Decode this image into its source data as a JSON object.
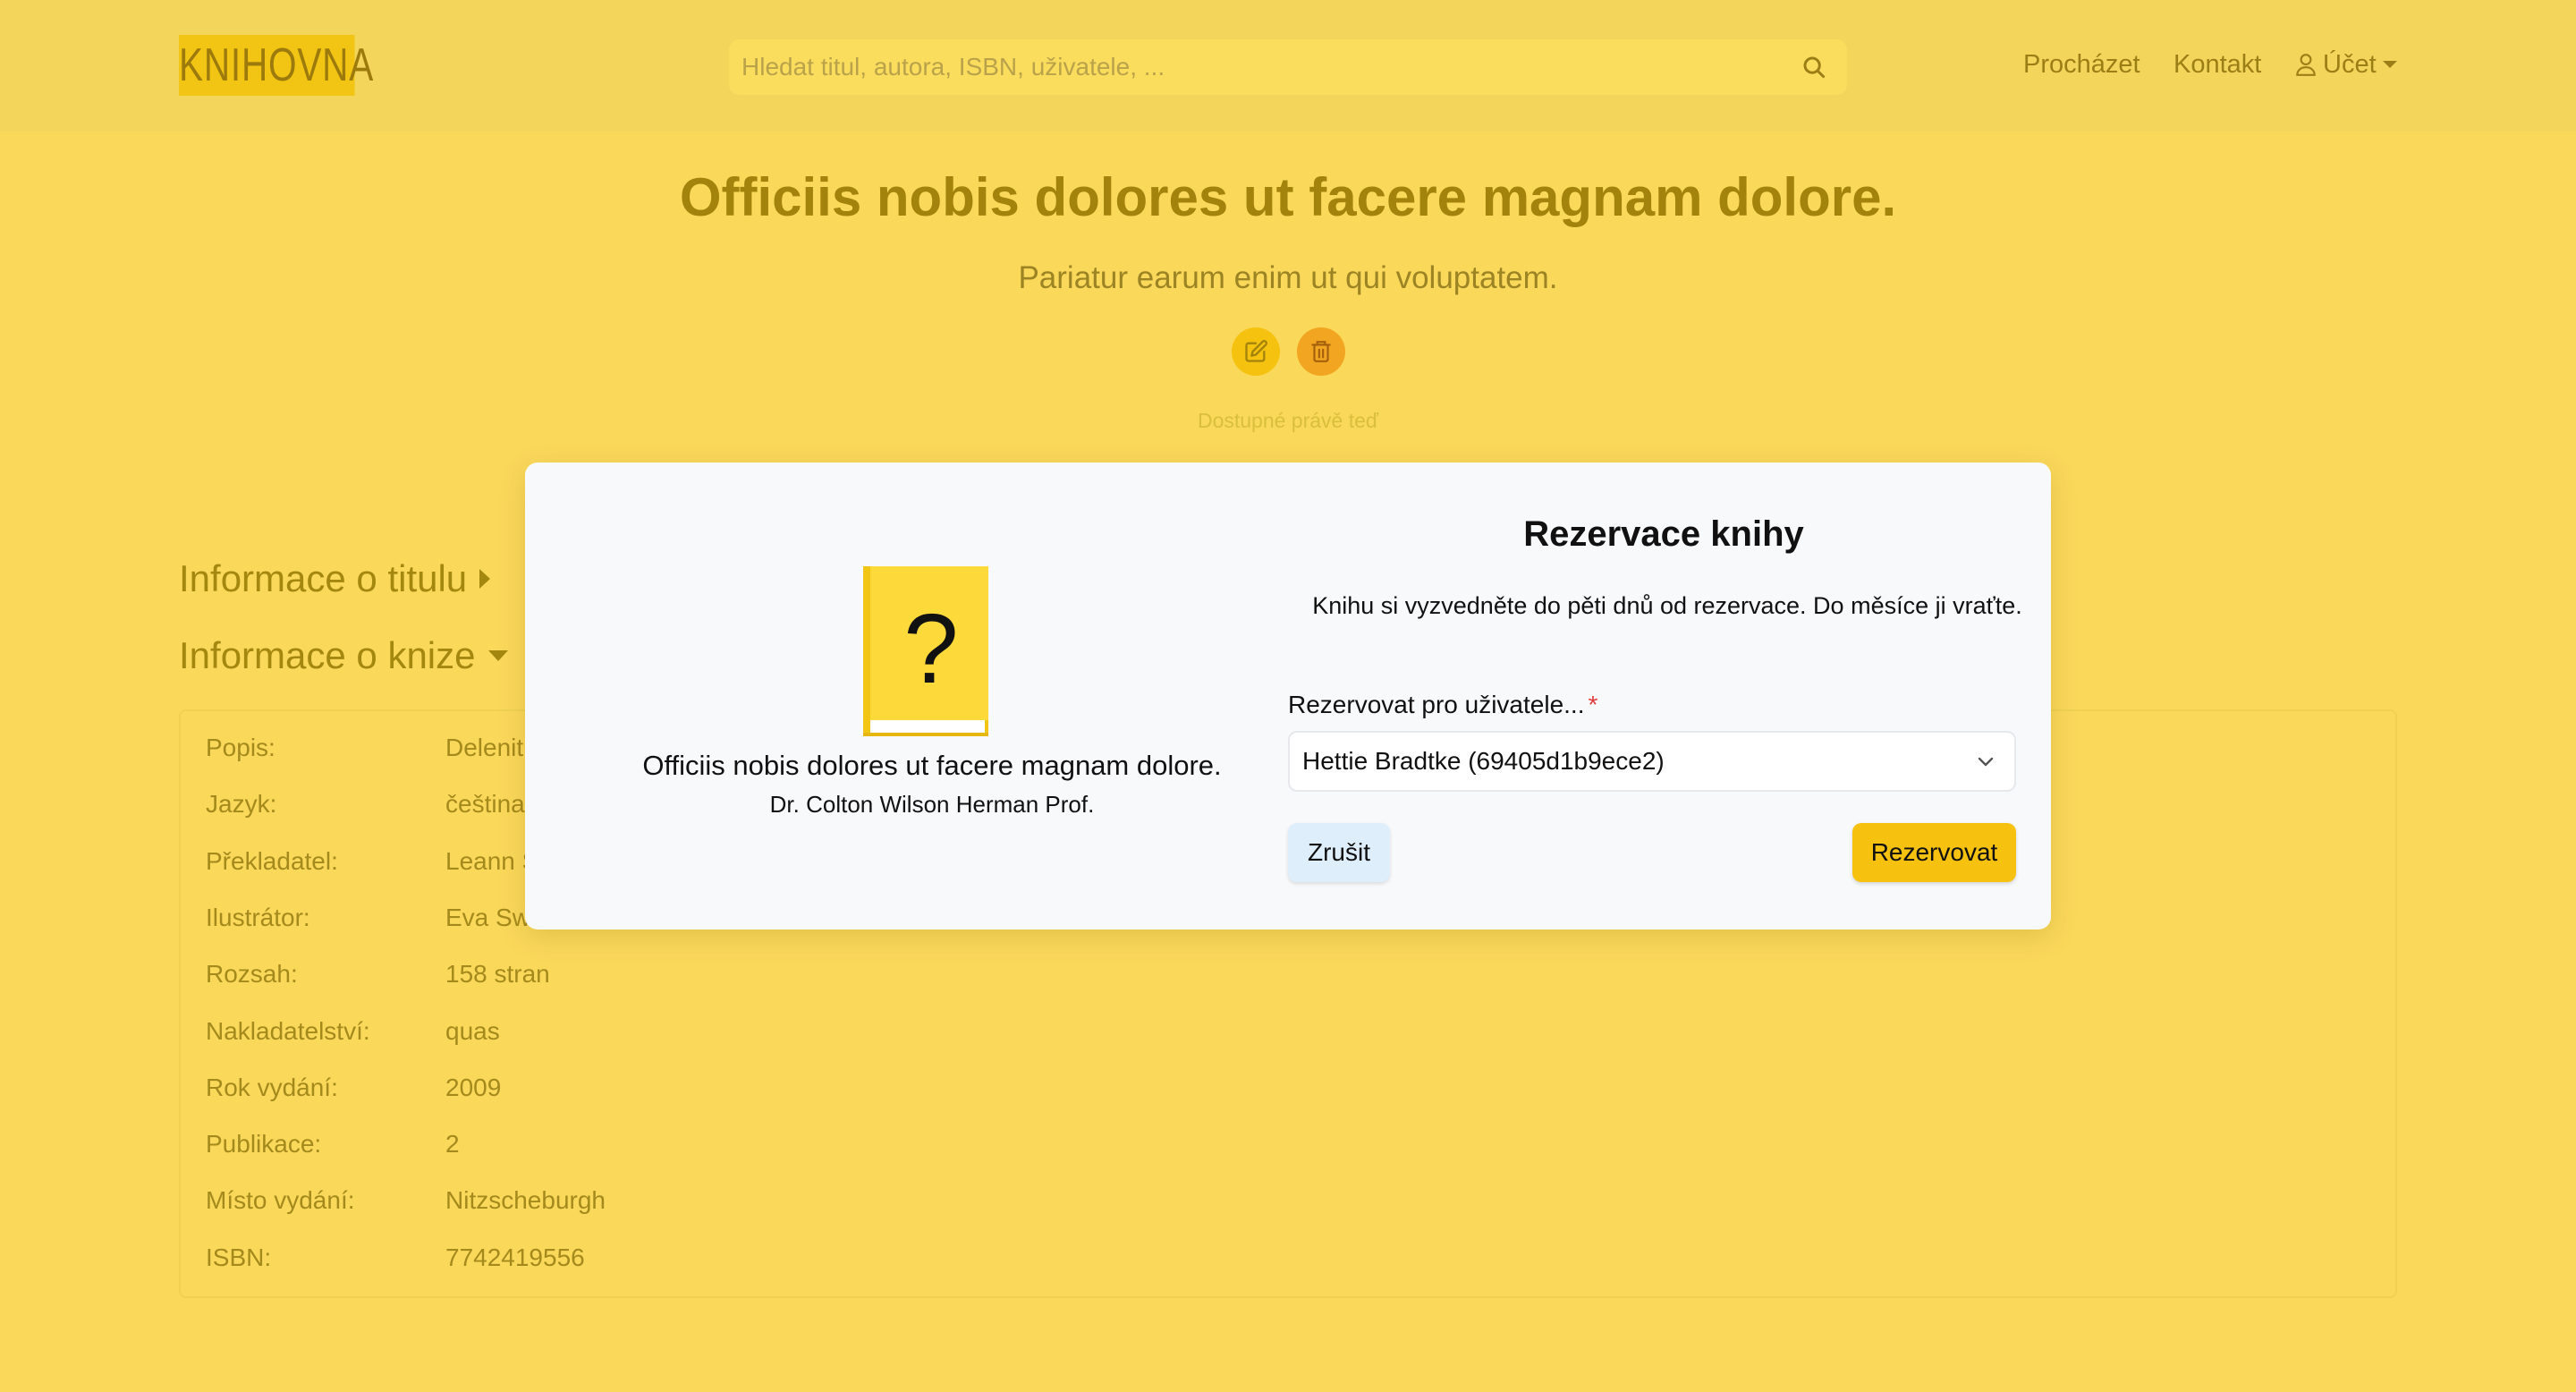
{
  "header": {
    "logo": "KNIHOVNA",
    "search_placeholder": "Hledat titul, autora, ISBN, uživatele, ...",
    "nav": {
      "browse": "Procházet",
      "contact": "Kontakt",
      "account": "Účet"
    }
  },
  "book": {
    "title": "Officiis nobis dolores ut facere magnam dolore.",
    "subtitle": "Pariatur earum enim ut qui voluptatem.",
    "availability": "Dostupné právě teď"
  },
  "sections": {
    "title_info": "Informace o titulu",
    "book_info": "Informace o knize"
  },
  "info_rows": [
    {
      "label": "Popis:",
      "value": "Delenit"
    },
    {
      "label": "Jazyk:",
      "value": "čeština"
    },
    {
      "label": "Překladatel:",
      "value": "Leann S"
    },
    {
      "label": "Ilustrátor:",
      "value": "Eva Sw"
    },
    {
      "label": "Rozsah:",
      "value": "158 stran"
    },
    {
      "label": "Nakladatelství:",
      "value": "quas"
    },
    {
      "label": "Rok vydání:",
      "value": "2009"
    },
    {
      "label": "Publikace:",
      "value": "2"
    },
    {
      "label": "Místo vydání:",
      "value": "Nitzscheburgh"
    },
    {
      "label": "ISBN:",
      "value": "7742419556"
    }
  ],
  "modal": {
    "cover_glyph": "?",
    "book_title": "Officiis nobis dolores ut facere magnam dolore.",
    "book_author": "Dr. Colton Wilson Herman Prof.",
    "heading": "Rezervace knihy",
    "description": "Knihu si vyzvedněte do pěti dnů od rezervace. Do měsíce ji vraťte.",
    "user_label": "Rezervovat pro uživatele...",
    "required_mark": "*",
    "selected_user": "Hettie Bradtke (69405d1b9ece2)",
    "cancel_label": "Zrušit",
    "reserve_label": "Rezervovat"
  },
  "colors": {
    "page_bg": "#fad85a",
    "header_bg": "#f3d55c",
    "accent": "#f6c20f",
    "delete": "#f2a520",
    "modal_bg": "#f8f9fb",
    "cancel_bg": "#dfeefb"
  }
}
